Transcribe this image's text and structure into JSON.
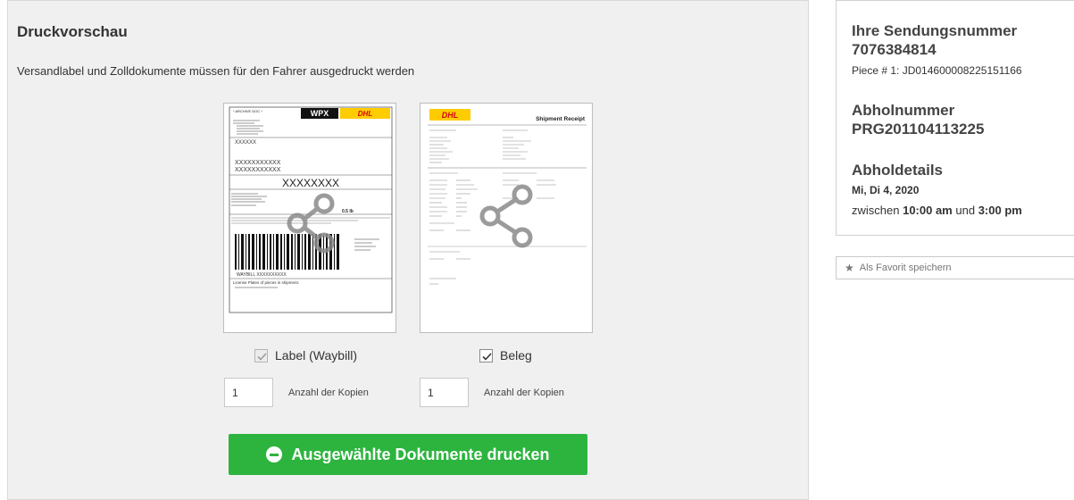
{
  "preview": {
    "title": "Druckvorschau",
    "subtitle": "Versandlabel und Zolldokumente müssen für den Fahrer ausgedruckt werden",
    "label_doc": {
      "archive": "* ARCHIVE DOC *",
      "product": "WPX",
      "brand": "DHL",
      "to_line": "XXXXXX",
      "address1": "XXXXXXXXXXX",
      "address2": "XXXXXXXXXXX",
      "routing": "XXXXXXXX",
      "weight": "0.5 lb",
      "waybill": "WAYBILL XXXXXXXXXX",
      "license_plates": "License Plates of pieces in shipment:"
    },
    "receipt_doc": {
      "brand": "DHL",
      "title": "Shipment Receipt"
    },
    "label_checkbox": {
      "text": "Label (Waybill)",
      "checked": true,
      "disabled": true
    },
    "receipt_checkbox": {
      "text": "Beleg",
      "checked": true,
      "disabled": false
    },
    "label_copies": {
      "value": "1",
      "label": "Anzahl der Kopien"
    },
    "receipt_copies": {
      "value": "1",
      "label": "Anzahl der Kopien"
    },
    "print_button": {
      "label": "Ausgewählte Dokumente drucken",
      "icon": "minus-circle-icon"
    }
  },
  "info": {
    "shipment_heading": "Ihre Sendungsnummer",
    "shipment_number": "7076384814",
    "piece": "Piece # 1: JD014600008225151166",
    "pickup_heading": "Abholnummer",
    "pickup_number": "PRG201104113225",
    "details_heading": "Abholdetails",
    "date": "Mi, Di 4, 2020",
    "time_prefix": "zwischen",
    "time_from": "10:00 am",
    "time_conj": "und",
    "time_to": "3:00 pm"
  },
  "favorite": {
    "label": "Als Favorit speichern",
    "icon": "star-icon"
  },
  "colors": {
    "accent_green": "#2db43f",
    "dhl_yellow": "#ffcc00",
    "dhl_red": "#d40511"
  }
}
